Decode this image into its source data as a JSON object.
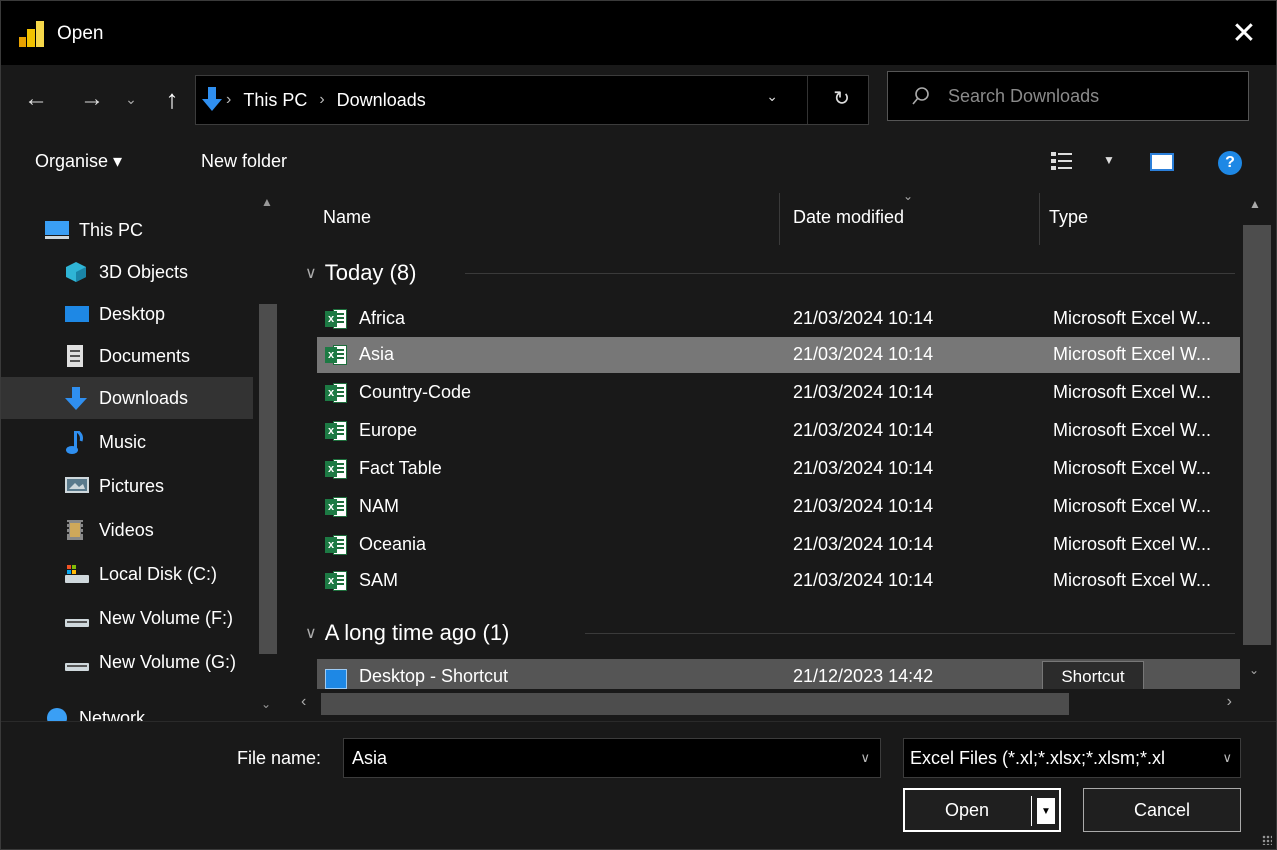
{
  "window": {
    "title": "Open",
    "close_glyph": "✕"
  },
  "nav": {
    "back_glyph": "←",
    "forward_glyph": "→",
    "recent_glyph": "⌄",
    "up_glyph": "↑",
    "breadcrumbs": [
      "This PC",
      "Downloads"
    ],
    "refresh_glyph": "↻",
    "search_placeholder": "Search Downloads"
  },
  "toolbar": {
    "organise_label": "Organise ▾",
    "new_folder_label": "New folder",
    "help_glyph": "?"
  },
  "sidebar": {
    "items": [
      {
        "label": "This PC",
        "icon": "pc-icon"
      },
      {
        "label": "3D Objects",
        "icon": "cube-icon"
      },
      {
        "label": "Desktop",
        "icon": "desktop-icon"
      },
      {
        "label": "Documents",
        "icon": "documents-icon"
      },
      {
        "label": "Downloads",
        "icon": "download-icon"
      },
      {
        "label": "Music",
        "icon": "music-icon"
      },
      {
        "label": "Pictures",
        "icon": "pictures-icon"
      },
      {
        "label": "Videos",
        "icon": "videos-icon"
      },
      {
        "label": "Local Disk (C:)",
        "icon": "drive-icon"
      },
      {
        "label": "New Volume (F:)",
        "icon": "drive-icon"
      },
      {
        "label": "New Volume (G:)",
        "icon": "drive-icon"
      },
      {
        "label": "Network",
        "icon": "network-icon"
      }
    ]
  },
  "columns": {
    "name": "Name",
    "date": "Date modified",
    "type": "Type"
  },
  "groups": [
    {
      "title": "Today (8)",
      "files": [
        {
          "name": "Africa",
          "date": "21/03/2024 10:14",
          "type": "Microsoft Excel W..."
        },
        {
          "name": "Asia",
          "date": "21/03/2024 10:14",
          "type": "Microsoft Excel W..."
        },
        {
          "name": "Country-Code",
          "date": "21/03/2024 10:14",
          "type": "Microsoft Excel W..."
        },
        {
          "name": "Europe",
          "date": "21/03/2024 10:14",
          "type": "Microsoft Excel W..."
        },
        {
          "name": "Fact Table",
          "date": "21/03/2024 10:14",
          "type": "Microsoft Excel W..."
        },
        {
          "name": "NAM",
          "date": "21/03/2024 10:14",
          "type": "Microsoft Excel W..."
        },
        {
          "name": "Oceania",
          "date": "21/03/2024 10:14",
          "type": "Microsoft Excel W..."
        },
        {
          "name": "SAM",
          "date": "21/03/2024 10:14",
          "type": "Microsoft Excel W..."
        }
      ]
    },
    {
      "title": "A long time ago (1)",
      "files": [
        {
          "name": "Desktop - Shortcut",
          "date": "21/12/2023 14:42",
          "type": "Shortcut"
        }
      ]
    }
  ],
  "tooltip": "Shortcut",
  "bottom": {
    "file_name_label": "File name:",
    "file_name_value": "Asia",
    "file_type_value": "Excel Files (*.xl;*.xlsx;*.xlsm;*.xl",
    "open_label": "Open",
    "cancel_label": "Cancel"
  },
  "colors": {
    "selected_row": "#777777",
    "accent": "#1e88e5",
    "excel_green": "#1d7a44"
  }
}
